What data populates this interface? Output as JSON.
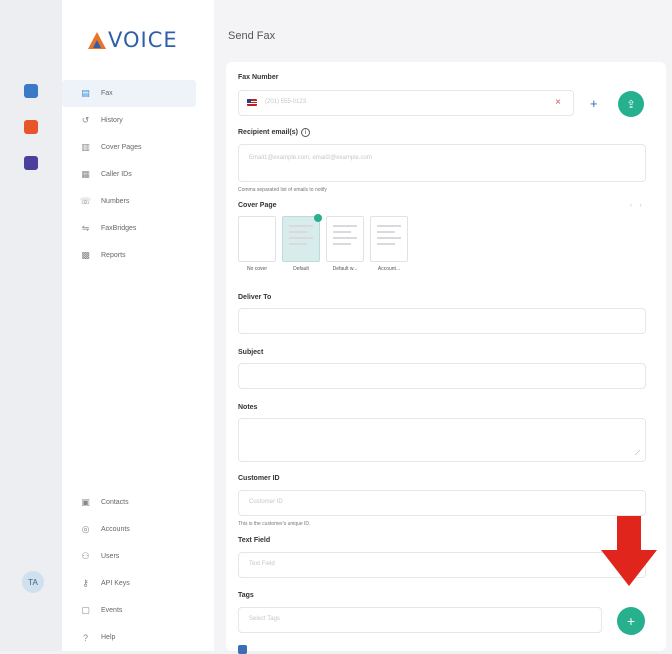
{
  "app": {
    "logo_text": "VOICE",
    "page_title": "Send Fax",
    "user_initials": "TA",
    "accent_color": "#27b08e",
    "brand_color": "#2f5fa8",
    "arrow_color": "#e0261c"
  },
  "sidebar": {
    "top_items": [
      {
        "label": "Fax",
        "icon": "fax-icon",
        "glyph": "▤",
        "active": true
      },
      {
        "label": "History",
        "icon": "history-icon",
        "glyph": "↺"
      },
      {
        "label": "Cover Pages",
        "icon": "cover-pages-icon",
        "glyph": "▥"
      },
      {
        "label": "Caller IDs",
        "icon": "caller-id-icon",
        "glyph": "▦"
      },
      {
        "label": "Numbers",
        "icon": "phone-icon",
        "glyph": "☏"
      },
      {
        "label": "FaxBridges",
        "icon": "faxbridge-icon",
        "glyph": "⇋"
      },
      {
        "label": "Reports",
        "icon": "reports-icon",
        "glyph": "▩"
      }
    ],
    "bottom_items": [
      {
        "label": "Contacts",
        "icon": "contacts-icon",
        "glyph": "▣"
      },
      {
        "label": "Accounts",
        "icon": "accounts-icon",
        "glyph": "◎"
      },
      {
        "label": "Users",
        "icon": "users-icon",
        "glyph": "⚇"
      },
      {
        "label": "API Keys",
        "icon": "key-icon",
        "glyph": "⚷"
      },
      {
        "label": "Events",
        "icon": "events-icon",
        "glyph": "▢"
      },
      {
        "label": "Help",
        "icon": "help-icon",
        "glyph": "?"
      }
    ]
  },
  "form": {
    "fax_number_label": "Fax Number",
    "fax_number_placeholder": "(201) 555-0123",
    "recipient_label": "Recipient email(s)",
    "recipient_placeholder": "Email1@example.com, email2@example.com",
    "recipient_hint": "Comma separated list of emails to notify",
    "cover_page_label": "Cover Page",
    "cover_options": [
      {
        "label": "No cover",
        "selected": false
      },
      {
        "label": "Default",
        "selected": true
      },
      {
        "label": "Default w...",
        "selected": false
      },
      {
        "label": "Account...",
        "selected": false
      }
    ],
    "deliver_to_label": "Deliver To",
    "subject_label": "Subject",
    "notes_label": "Notes",
    "customer_id_label": "Customer ID",
    "customer_id_placeholder": "Customer ID",
    "customer_id_hint": "This is the customer's unique ID.",
    "text_field_label": "Text Field",
    "text_field_placeholder": "Text Field",
    "tags_label": "Tags",
    "tags_placeholder": "Select Tags"
  }
}
